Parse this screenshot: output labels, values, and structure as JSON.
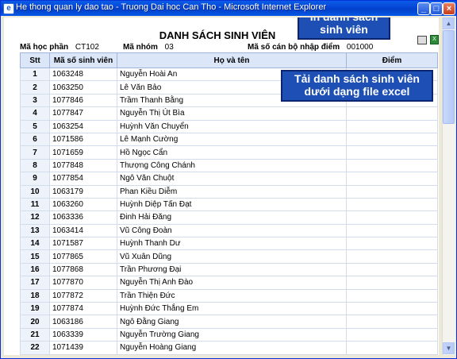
{
  "window": {
    "title": "He thong quan ly dao tao - Truong Dai hoc Can Tho - Microsoft Internet Explorer"
  },
  "page": {
    "heading": "DANH SÁCH SINH VIÊN",
    "course_label": "Mã học phần",
    "course_value": "CT102",
    "group_label": "Mã nhóm",
    "group_value": "03",
    "staff_label": "Mã số cán bộ nhập điểm",
    "staff_value": "001000"
  },
  "callouts": {
    "print": "In danh sách sinh viên",
    "excel": "Tải danh sách sinh viên dưới dạng file excel"
  },
  "table": {
    "columns": [
      "Stt",
      "Mã số sinh viên",
      "Họ và tên",
      "Điểm"
    ],
    "rows": [
      {
        "stt": "1",
        "id": "1063248",
        "name": "Nguyễn Hoài An"
      },
      {
        "stt": "2",
        "id": "1063250",
        "name": "Lê Văn Bảo"
      },
      {
        "stt": "3",
        "id": "1077846",
        "name": "Trầm Thanh Bằng"
      },
      {
        "stt": "4",
        "id": "1077847",
        "name": "Nguyễn Thị Út Bìa"
      },
      {
        "stt": "5",
        "id": "1063254",
        "name": "Huỳnh Văn Chuyển"
      },
      {
        "stt": "6",
        "id": "1071586",
        "name": "Lê Mạnh Cường"
      },
      {
        "stt": "7",
        "id": "1071659",
        "name": "Hồ Ngọc Cẩn"
      },
      {
        "stt": "8",
        "id": "1077848",
        "name": "Thượng Công Chánh"
      },
      {
        "stt": "9",
        "id": "1077854",
        "name": "Ngô Văn Chuột"
      },
      {
        "stt": "10",
        "id": "1063179",
        "name": "Phan Kiều Diễm"
      },
      {
        "stt": "11",
        "id": "1063260",
        "name": "Huỳnh Diệp Tấn Đạt"
      },
      {
        "stt": "12",
        "id": "1063336",
        "name": "Đinh Hải Đăng"
      },
      {
        "stt": "13",
        "id": "1063414",
        "name": "Vũ Công Đoàn"
      },
      {
        "stt": "14",
        "id": "1071587",
        "name": "Huỳnh Thanh Dư"
      },
      {
        "stt": "15",
        "id": "1077865",
        "name": "Vũ Xuân Dũng"
      },
      {
        "stt": "16",
        "id": "1077868",
        "name": "Trần Phương Đại"
      },
      {
        "stt": "17",
        "id": "1077870",
        "name": "Nguyễn Thị Anh Đào"
      },
      {
        "stt": "18",
        "id": "1077872",
        "name": "Trần Thiện Đức"
      },
      {
        "stt": "19",
        "id": "1077874",
        "name": "Huỳnh Đức Thắng Em"
      },
      {
        "stt": "20",
        "id": "1063186",
        "name": "Ngô Đằng Giang"
      },
      {
        "stt": "21",
        "id": "1063339",
        "name": "Nguyễn Trường Giang"
      },
      {
        "stt": "22",
        "id": "1071439",
        "name": "Nguyễn Hoàng Giang"
      }
    ]
  }
}
